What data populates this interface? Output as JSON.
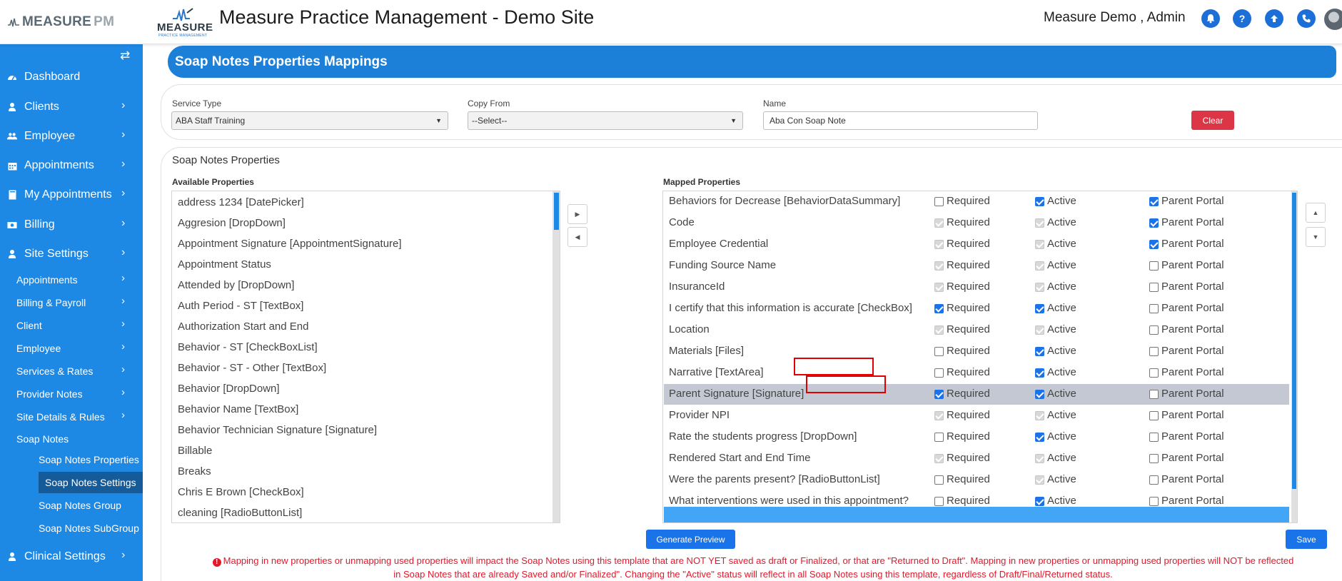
{
  "header": {
    "brand_main": "MEASURE",
    "brand_pm": "PM",
    "center_logo_text": "MEASURE",
    "center_logo_sub": "PRACTICE MANAGEMENT",
    "site_title": "Measure Practice Management - Demo Site",
    "user_name": "Measure Demo , Admin",
    "icons": [
      "bell-icon",
      "question-icon",
      "upload-icon",
      "phone-icon"
    ],
    "accent_color": "#1d6fd8"
  },
  "sidebar": {
    "bg_color": "#1e88e5",
    "items": [
      {
        "label": "Dashboard",
        "icon": "dashboard-icon"
      },
      {
        "label": "Clients",
        "icon": "user-icon"
      },
      {
        "label": "Employee",
        "icon": "users-icon"
      },
      {
        "label": "Appointments",
        "icon": "calendar-icon"
      },
      {
        "label": "My Appointments",
        "icon": "book-icon"
      },
      {
        "label": "Billing",
        "icon": "money-icon"
      },
      {
        "label": "Site Settings",
        "icon": "user-icon"
      }
    ],
    "site_settings_sub": [
      "Appointments",
      "Billing & Payroll",
      "Client",
      "Employee",
      "Services & Rates",
      "Provider Notes",
      "Site Details & Rules",
      "Soap Notes"
    ],
    "soap_notes_sub": [
      "Soap Notes Properties",
      "Soap Notes Settings",
      "Soap Notes Group",
      "Soap Notes SubGroup"
    ],
    "clinical_settings": "Clinical Settings"
  },
  "page": {
    "title": "Soap Notes Properties Mappings",
    "service_type_label": "Service Type",
    "service_type_value": "ABA Staff Training",
    "copy_from_label": "Copy From",
    "copy_from_value": "--Select--",
    "name_label": "Name",
    "name_value": "Aba Con Soap Note",
    "clear_label": "Clear",
    "section_title": "Soap Notes Properties",
    "available_label": "Available Properties",
    "mapped_label": "Mapped Properties",
    "generate_preview_label": "Generate Preview",
    "save_label": "Save",
    "warning_line1": "Mapping in new properties or unmapping used properties will impact the Soap Notes using this template that are NOT YET saved as draft or Finalized, or that are \"Returned to Draft\". Mapping in new properties or unmapping used properties will NOT be reflected",
    "warning_line2": "in Soap Notes that are already Saved and/or Finalized\". Changing the \"Active\" status will reflect in all Soap Notes using this template, regardless of Draft/Final/Returned status."
  },
  "available_properties": [
    "address 1234 [DatePicker]",
    "Aggresion [DropDown]",
    "Appointment Signature [AppointmentSignature]",
    "Appointment Status",
    "Attended by [DropDown]",
    "Auth Period - ST [TextBox]",
    "Authorization Start and End",
    "Behavior - ST [CheckBoxList]",
    "Behavior - ST - Other [TextBox]",
    "Behavior [DropDown]",
    "Behavior Name [TextBox]",
    "Behavior Technician Signature [Signature]",
    "Billable",
    "Breaks",
    "Chris E Brown [CheckBox]",
    "cleaning [RadioButtonList]"
  ],
  "checkbox_labels": {
    "required": "Required",
    "active": "Active",
    "parent_portal": "Parent Portal"
  },
  "mapped_properties": [
    {
      "name": "Behaviors for Decrease [BehaviorDataSummary]",
      "required": "off",
      "active": "on",
      "parent": "on"
    },
    {
      "name": "Code",
      "required": "dis",
      "active": "dis",
      "parent": "on"
    },
    {
      "name": "Employee Credential",
      "required": "dis",
      "active": "dis",
      "parent": "on"
    },
    {
      "name": "Funding Source Name",
      "required": "dis",
      "active": "dis",
      "parent": "off"
    },
    {
      "name": "InsuranceId",
      "required": "dis",
      "active": "dis",
      "parent": "off"
    },
    {
      "name": "I certify that this information is accurate [CheckBox]",
      "required": "on",
      "active": "on",
      "parent": "off"
    },
    {
      "name": "Location",
      "required": "dis",
      "active": "dis",
      "parent": "off"
    },
    {
      "name": "Materials [Files]",
      "required": "off",
      "active": "on",
      "parent": "off"
    },
    {
      "name": "Narrative [TextArea]",
      "required": "off",
      "active": "on",
      "parent": "off"
    },
    {
      "name": "Parent Signature [Signature]",
      "required": "on",
      "active": "on",
      "parent": "off",
      "highlighted": true
    },
    {
      "name": "Provider NPI",
      "required": "dis",
      "active": "dis",
      "parent": "off"
    },
    {
      "name": "Rate the students progress [DropDown]",
      "required": "off",
      "active": "on",
      "parent": "off"
    },
    {
      "name": "Rendered Start and End Time",
      "required": "dis",
      "active": "dis",
      "parent": "off"
    },
    {
      "name": "Were the parents present? [RadioButtonList]",
      "required": "off",
      "active": "dis",
      "parent": "off"
    },
    {
      "name": "What interventions were used in this appointment?",
      "required": "off",
      "active": "on",
      "parent": "off"
    }
  ],
  "colors": {
    "title_bar": "#1c7fd8",
    "clear_button": "#dc3545",
    "primary_button": "#1a73e8",
    "warning_text": "#e0192b",
    "highlight_row": "#c3c8d3",
    "annotation_box": "#e00000"
  }
}
